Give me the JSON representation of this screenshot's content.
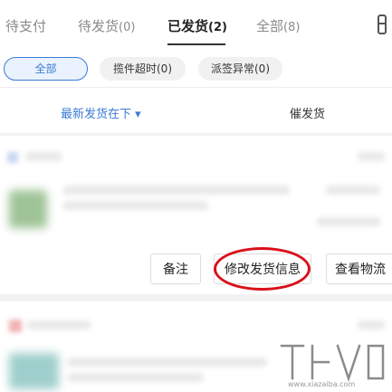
{
  "tabs": [
    {
      "label": "待支付",
      "count": ""
    },
    {
      "label": "待发货",
      "count": "(0)"
    },
    {
      "label": "已发货",
      "count": "(2)"
    },
    {
      "label": "全部",
      "count": "(8)"
    }
  ],
  "filters": [
    {
      "label": "全部"
    },
    {
      "label": "揽件超时(0)"
    },
    {
      "label": "派签异常(0)"
    }
  ],
  "sort": {
    "label": "最新发货在下",
    "caret": "▾",
    "urge": "催发货"
  },
  "actions": {
    "note": "备注",
    "modify": "修改发货信息",
    "track": "查看物流"
  },
  "watermark": {
    "domain": "www.xiazaiba.com"
  }
}
